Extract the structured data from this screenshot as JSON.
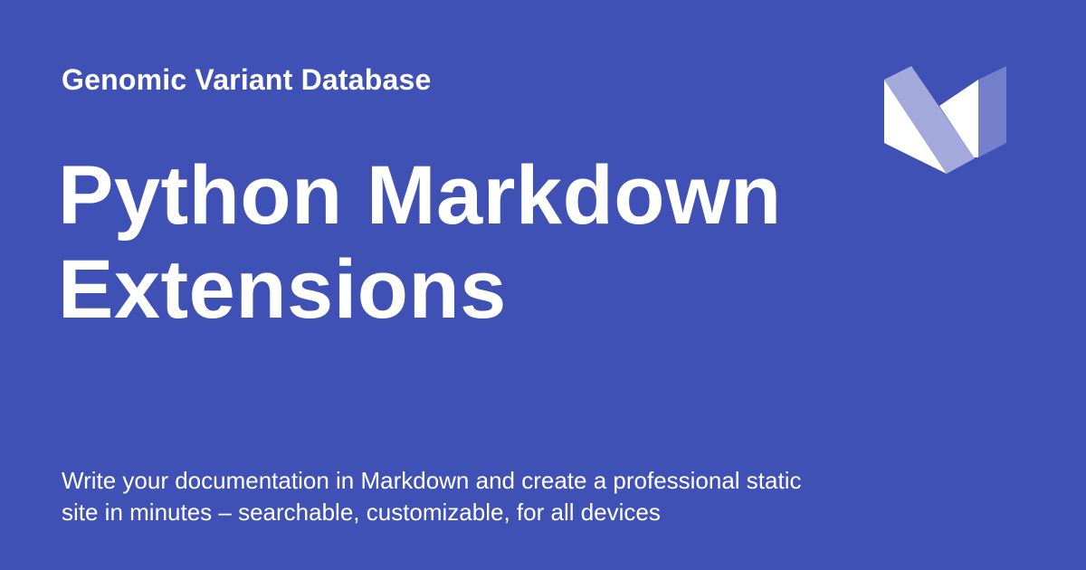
{
  "site_name": "Genomic Variant Database",
  "page_title": "Python Markdown Extensions",
  "description": "Write your documentation in Markdown and create a professional static site in minutes – searchable, customizable, for all devices",
  "logo_icon": "material-logo-icon",
  "colors": {
    "background": "#3f51b5",
    "text": "#ffffff"
  }
}
